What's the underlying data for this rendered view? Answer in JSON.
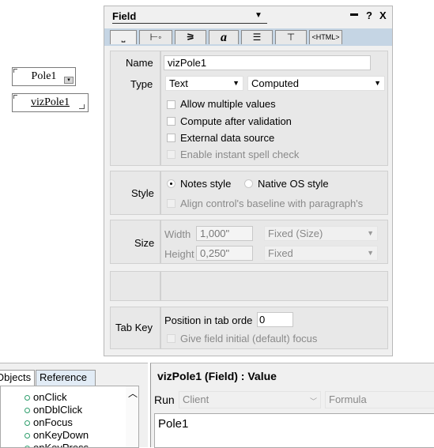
{
  "canvas": {
    "field1": "Pole1",
    "field2": "vizPole1"
  },
  "props": {
    "title": "Field",
    "title_controls": {
      "minimize": "▬",
      "help": "?",
      "close": "X"
    },
    "tabs": [
      {
        "label": "⎵",
        "icon": "basics-icon"
      },
      {
        "label": "⊢◦",
        "icon": "control-icon"
      },
      {
        "label": "⚞",
        "icon": "hide-when-icon"
      },
      {
        "label": "a",
        "icon": "font-icon"
      },
      {
        "label": "☰",
        "icon": "paragraph-icon"
      },
      {
        "label": "⊤",
        "icon": "paragraph-hide-icon"
      },
      {
        "label": "<HTML>",
        "icon": "html-icon"
      }
    ],
    "name_label": "Name",
    "name_value": "vizPole1",
    "type_label": "Type",
    "type_value": "Text",
    "computed_value": "Computed",
    "options": {
      "allow_multiple": "Allow multiple values",
      "compute_after": "Compute after validation",
      "external_source": "External data source",
      "spell_check": "Enable instant spell check"
    },
    "style_label": "Style",
    "style_notes": "Notes style",
    "style_native": "Native OS style",
    "align_baseline": "Align control's baseline with paragraph's",
    "size_label": "Size",
    "width_label": "Width",
    "width_value": "1,000\"",
    "width_mode": "Fixed (Size)",
    "height_label": "Height",
    "height_value": "0,250\"",
    "height_mode": "Fixed",
    "tabkey_label": "Tab Key",
    "tab_order_label": "Position in tab orde",
    "tab_order_value": "0",
    "initial_focus": "Give field initial (default) focus"
  },
  "ref_pane": {
    "tab_objects": "Objects",
    "tab_reference": "Reference",
    "events": [
      "onClick",
      "onDblClick",
      "onFocus",
      "onKeyDown",
      "onKeyPress"
    ]
  },
  "code_pane": {
    "title": "vizPole1 (Field) : Value",
    "run_label": "Run",
    "run_value": "Client",
    "lang_value": "Formula",
    "code": "Pole1"
  }
}
